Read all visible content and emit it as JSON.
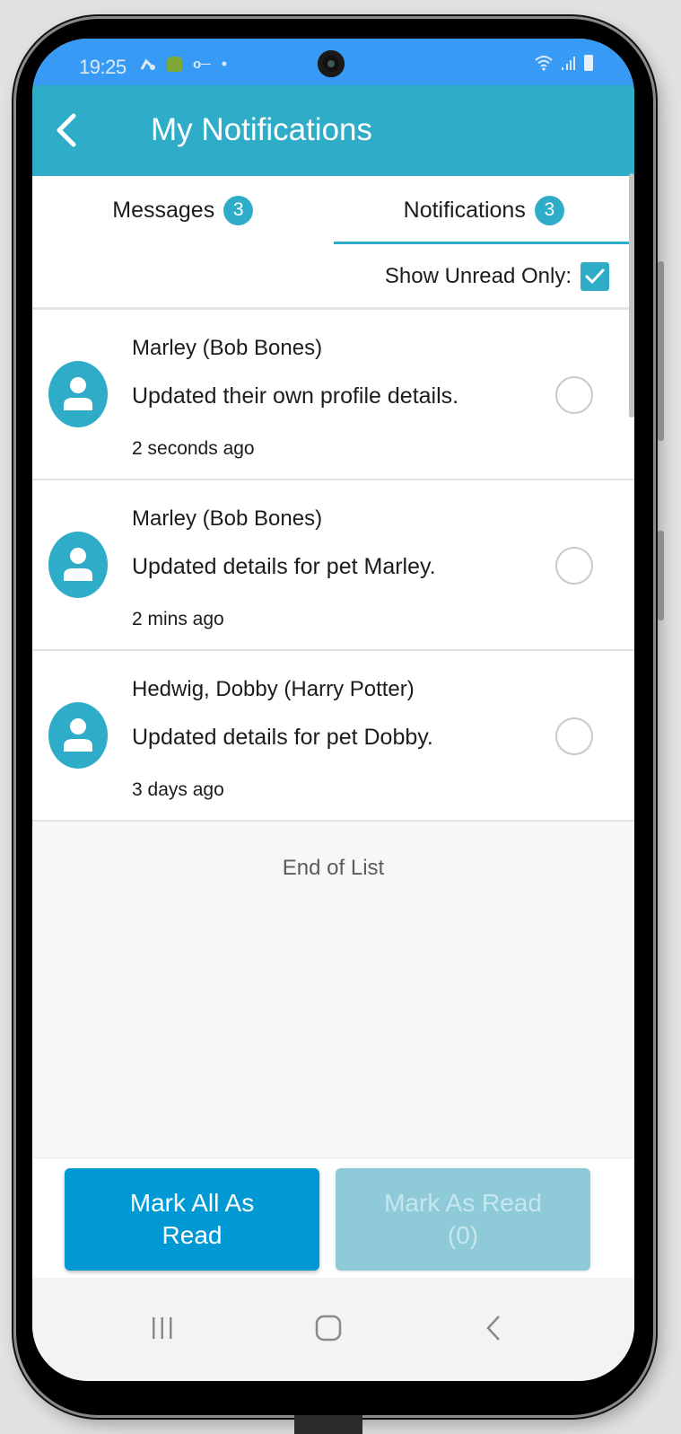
{
  "status_bar": {
    "time": "19:25",
    "left_icons": [
      "sync-arrow-icon",
      "android-icon",
      "key-icon",
      "dot-icon"
    ],
    "right_icons": [
      "wifi-icon",
      "signal-icon",
      "battery-icon"
    ],
    "key_glyph": "o─",
    "dot_glyph": "•",
    "signal_glyph": ".┃"
  },
  "app_bar": {
    "title": "My Notifications",
    "back_icon": "chevron-left-icon"
  },
  "tabs": [
    {
      "label": "Messages",
      "badge": "3",
      "active": false
    },
    {
      "label": "Notifications",
      "badge": "3",
      "active": true
    }
  ],
  "filter": {
    "label": "Show Unread Only:",
    "checked": true
  },
  "notifications": [
    {
      "title": "Marley (Bob Bones)",
      "body": "Updated their own profile details.",
      "time": "2 seconds ago",
      "selected": false
    },
    {
      "title": "Marley (Bob Bones)",
      "body": "Updated details for pet Marley.",
      "time": "2 mins ago",
      "selected": false
    },
    {
      "title": "Hedwig, Dobby (Harry Potter)",
      "body": "Updated details for pet Dobby.",
      "time": "3 days ago",
      "selected": false
    }
  ],
  "end_of_list": "End of List",
  "actions": {
    "mark_all": "Mark All As Read",
    "mark_selected": "Mark As Read (0)",
    "mark_selected_enabled": false
  },
  "colors": {
    "status_bar": "#379bf6",
    "accent": "#2fadc8",
    "primary_button": "#0099d3",
    "disabled_button": "#8ecad8"
  }
}
